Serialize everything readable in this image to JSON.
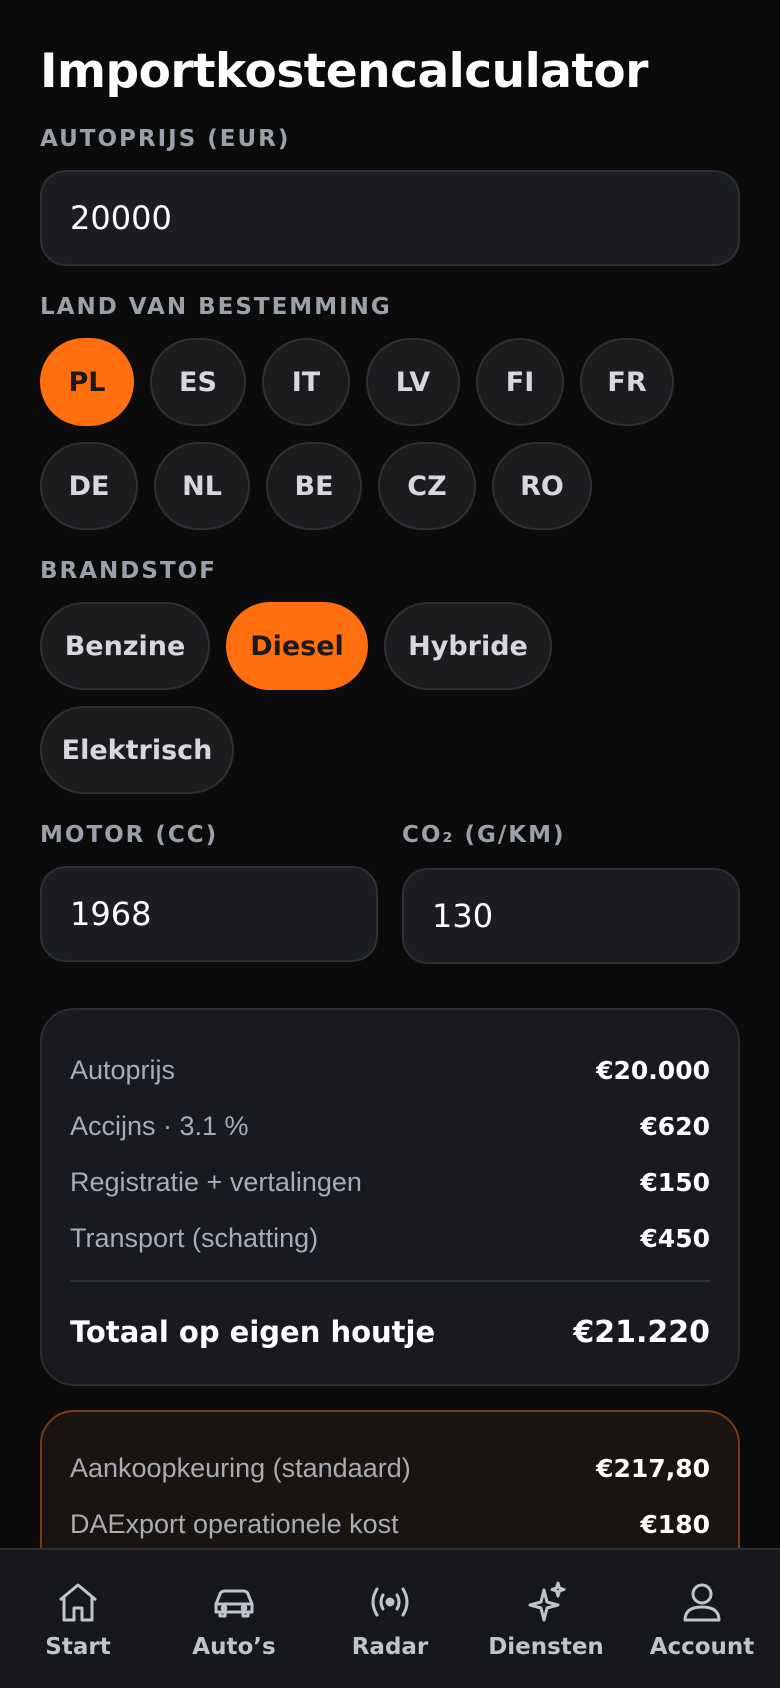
{
  "title": "Importkostencalculator",
  "price": {
    "label": "AUTOPRIJS (EUR)",
    "value": "20000"
  },
  "destination": {
    "label": "LAND VAN BESTEMMING",
    "countries": [
      "PL",
      "ES",
      "IT",
      "LV",
      "FI",
      "FR",
      "DE",
      "NL",
      "BE",
      "CZ",
      "RO"
    ],
    "selected": "PL"
  },
  "fuel": {
    "label": "BRANDSTOF",
    "options": [
      "Benzine",
      "Diesel",
      "Hybride",
      "Elektrisch"
    ],
    "selected": "Diesel"
  },
  "engine": {
    "label": "MOTOR (CC)",
    "value": "1968"
  },
  "co2": {
    "label": "CO₂ (G/KM)",
    "value": "130"
  },
  "summary": {
    "rows": [
      {
        "label": "Autoprijs",
        "value": "€20.000"
      },
      {
        "label": "Accijns · 3.1 %",
        "value": "€620"
      },
      {
        "label": "Registratie + vertalingen",
        "value": "€150"
      },
      {
        "label": "Transport (schatting)",
        "value": "€450"
      }
    ],
    "total_label": "Totaal op eigen houtje",
    "total_value": "€21.220"
  },
  "service": {
    "rows": [
      {
        "label": "Aankoopkeuring (standaard)",
        "value": "€217,80"
      },
      {
        "label": "DAExport operationele kost",
        "value": "€180"
      }
    ]
  },
  "nav": {
    "items": [
      {
        "label": "Start",
        "icon": "home-icon"
      },
      {
        "label": "Auto’s",
        "icon": "car-icon"
      },
      {
        "label": "Radar",
        "icon": "radar-icon"
      },
      {
        "label": "Diensten",
        "icon": "sparkle-icon"
      },
      {
        "label": "Account",
        "icon": "user-icon"
      }
    ]
  },
  "colors": {
    "accent": "#ff6f0f",
    "background": "#0b0b0c",
    "card": "#181a1f"
  }
}
